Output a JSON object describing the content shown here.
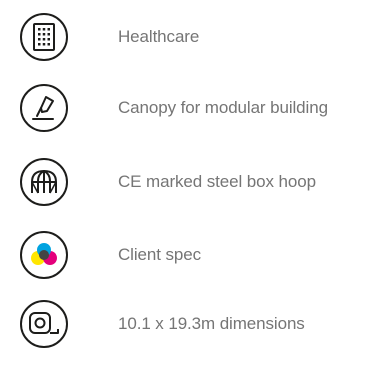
{
  "features": [
    {
      "label": "Healthcare",
      "icon": "hospital-building-icon"
    },
    {
      "label": "Canopy for modular building",
      "icon": "pen-design-icon"
    },
    {
      "label": "CE marked steel box hoop",
      "icon": "hoop-frame-icon"
    },
    {
      "label": "Client spec",
      "icon": "color-circles-icon"
    },
    {
      "label": "10.1 x 19.3m dimensions",
      "icon": "tape-measure-icon"
    }
  ],
  "colors": {
    "text": "#757575",
    "icon_stroke": "#1d1d1b",
    "cmyk_cyan": "#00a3e0",
    "cmyk_magenta": "#e4007c",
    "cmyk_yellow": "#ffe600",
    "cmyk_black": "#444444"
  }
}
